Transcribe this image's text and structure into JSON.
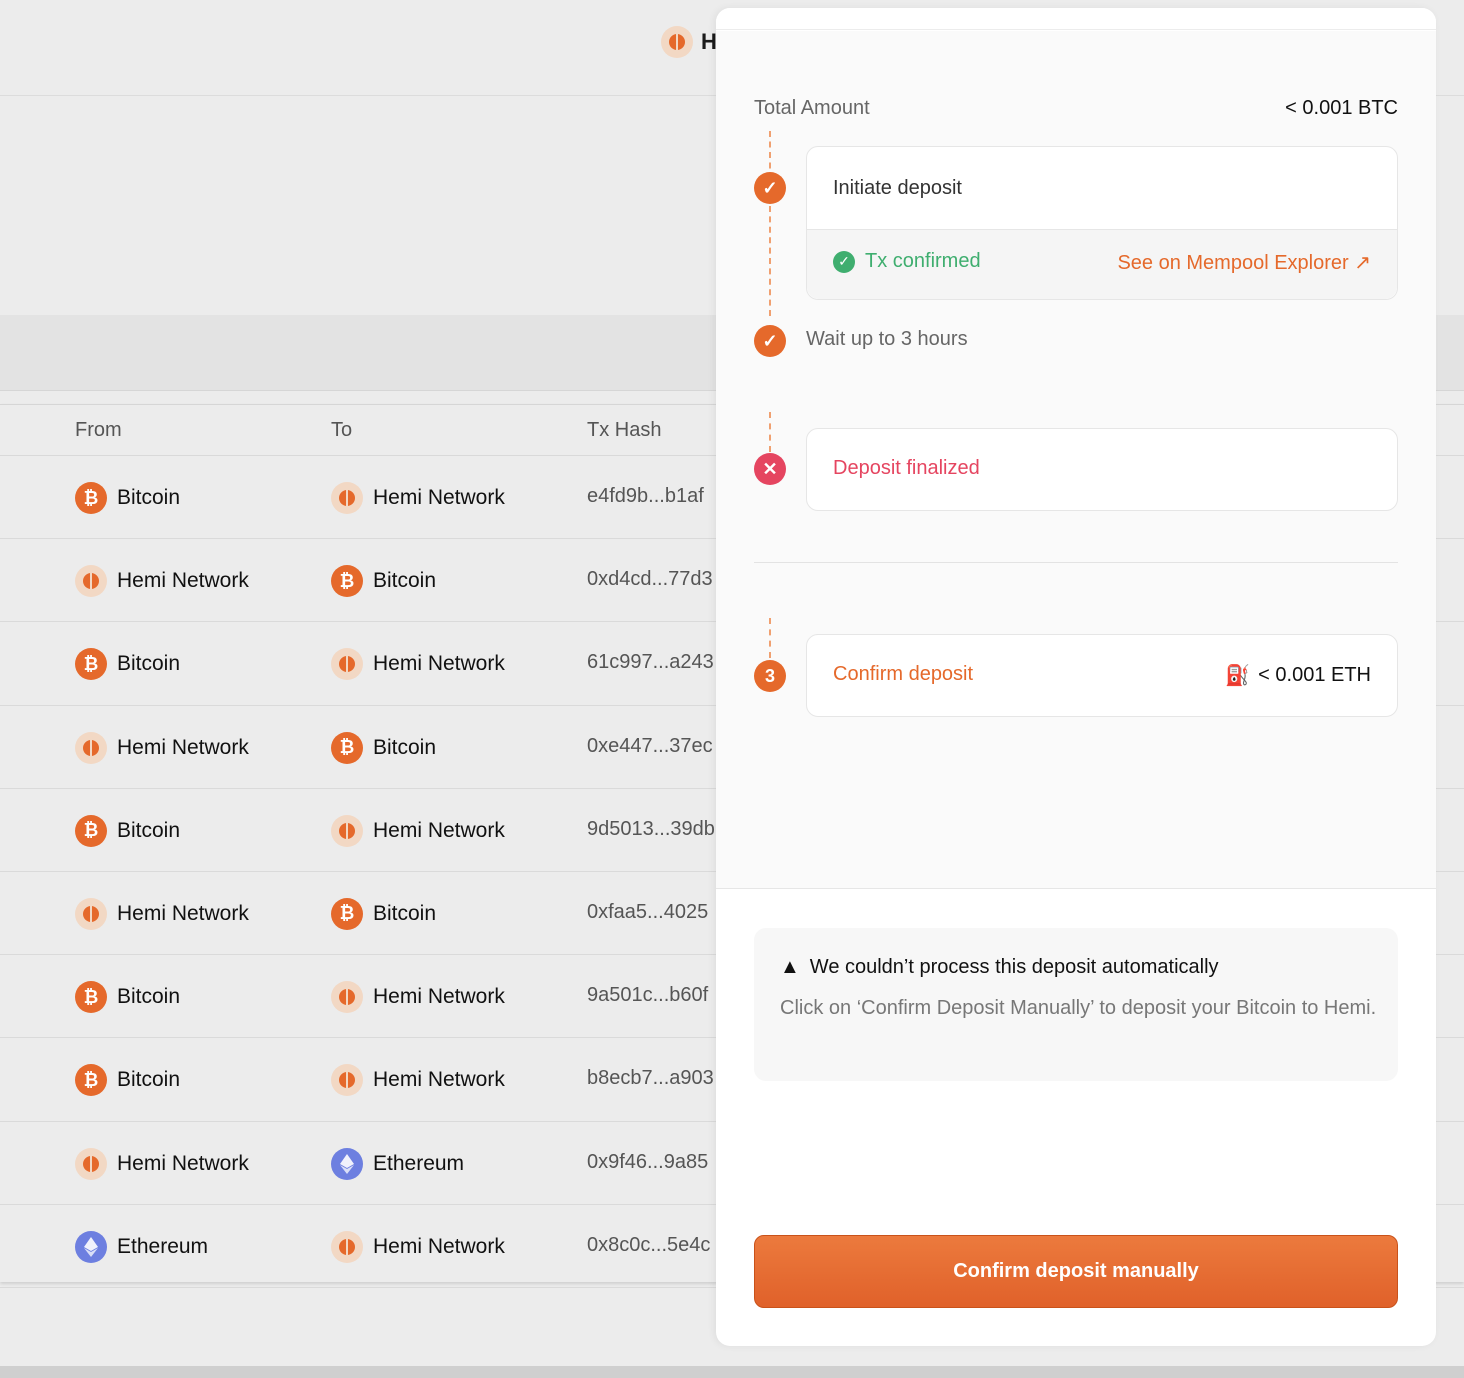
{
  "background": {
    "brand_partial": "He",
    "table": {
      "headers": [
        "From",
        "To",
        "Tx Hash"
      ],
      "rows": [
        {
          "from": "Bitcoin",
          "from_icon": "btc",
          "to": "Hemi Network",
          "to_icon": "hemi",
          "hash": "e4fd9b...b1af"
        },
        {
          "from": "Hemi Network",
          "from_icon": "hemi",
          "to": "Bitcoin",
          "to_icon": "btc",
          "hash": "0xd4cd...77d3"
        },
        {
          "from": "Bitcoin",
          "from_icon": "btc",
          "to": "Hemi Network",
          "to_icon": "hemi",
          "hash": "61c997...a243"
        },
        {
          "from": "Hemi Network",
          "from_icon": "hemi",
          "to": "Bitcoin",
          "to_icon": "btc",
          "hash": "0xe447...37ec"
        },
        {
          "from": "Bitcoin",
          "from_icon": "btc",
          "to": "Hemi Network",
          "to_icon": "hemi",
          "hash": "9d5013...39db"
        },
        {
          "from": "Hemi Network",
          "from_icon": "hemi",
          "to": "Bitcoin",
          "to_icon": "btc",
          "hash": "0xfaa5...4025"
        },
        {
          "from": "Bitcoin",
          "from_icon": "btc",
          "to": "Hemi Network",
          "to_icon": "hemi",
          "hash": "9a501c...b60f"
        },
        {
          "from": "Bitcoin",
          "from_icon": "btc",
          "to": "Hemi Network",
          "to_icon": "hemi",
          "hash": "b8ecb7...a903"
        },
        {
          "from": "Hemi Network",
          "from_icon": "hemi",
          "to": "Ethereum",
          "to_icon": "eth",
          "hash": "0x9f46...9a85"
        },
        {
          "from": "Ethereum",
          "from_icon": "eth",
          "to": "Hemi Network",
          "to_icon": "hemi",
          "hash": "0x8c0c...5e4c"
        }
      ]
    }
  },
  "drawer": {
    "total_label": "Total Amount",
    "total_value": "< 0.001 BTC",
    "steps": {
      "initiate": {
        "title": "Initiate deposit",
        "status": "Tx confirmed",
        "link": "See on Mempool Explorer ↗"
      },
      "wait": {
        "label": "Wait up to 3 hours"
      },
      "finalized": {
        "title": "Deposit finalized"
      },
      "confirm": {
        "number": "3",
        "title": "Confirm deposit",
        "gas": "< 0.001 ETH"
      }
    },
    "warning": {
      "title": "We couldn’t process this deposit automatically",
      "text": "Click on ‘Confirm Deposit Manually’ to deposit your Bitcoin to Hemi."
    },
    "confirm_button": "Confirm deposit manually"
  },
  "colors": {
    "accent": "#e5692b",
    "success": "#3fae6f",
    "error": "#e54560"
  }
}
